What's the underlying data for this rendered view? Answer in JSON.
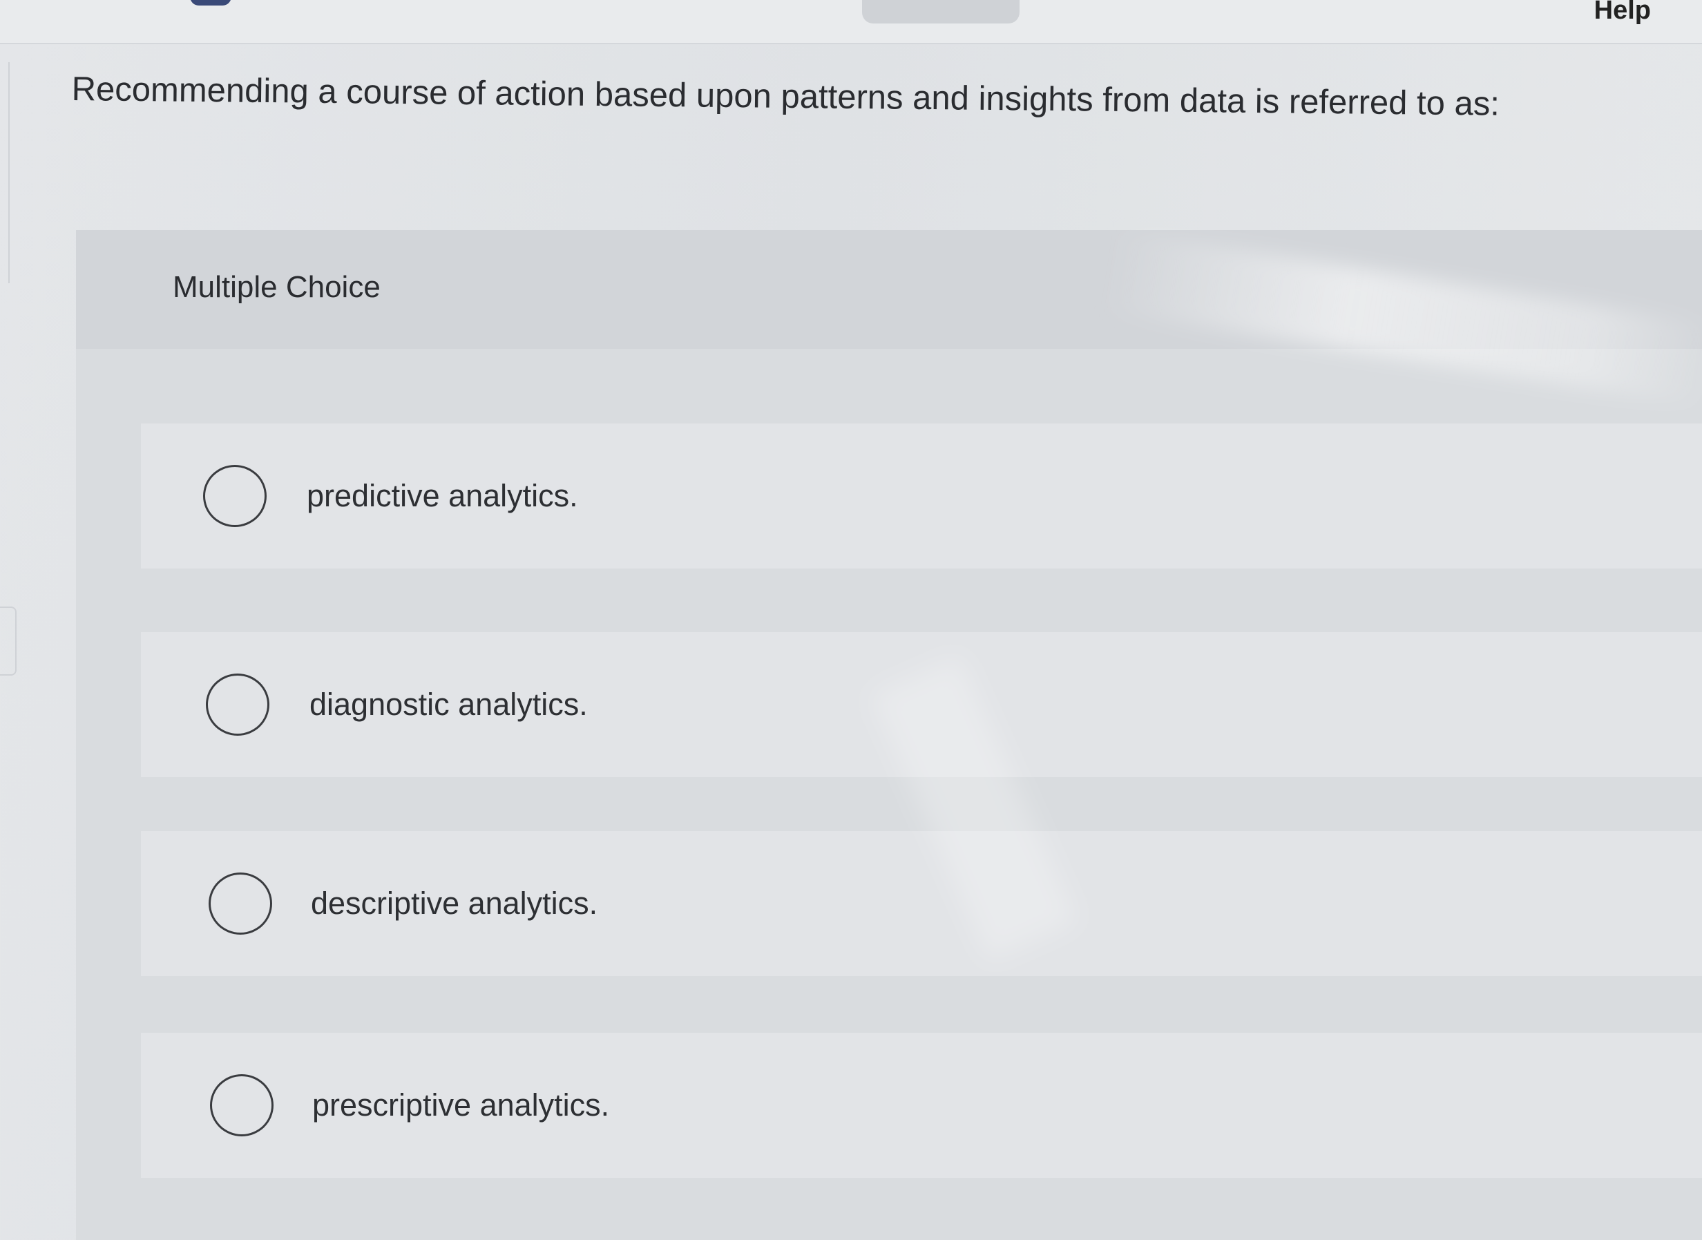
{
  "header": {
    "help_label": "Help"
  },
  "question": {
    "text": "Recommending a course of action based upon patterns and insights from data is referred to as:"
  },
  "choice_block": {
    "type_label": "Multiple Choice",
    "options": [
      {
        "label": "predictive analytics.",
        "selected": false
      },
      {
        "label": "diagnostic analytics.",
        "selected": false
      },
      {
        "label": "descriptive analytics.",
        "selected": false
      },
      {
        "label": "prescriptive analytics.",
        "selected": false
      }
    ]
  },
  "colors": {
    "panel_background": "#d9dcdf",
    "option_background": "#e2e4e7",
    "text": "#2d2f33"
  }
}
